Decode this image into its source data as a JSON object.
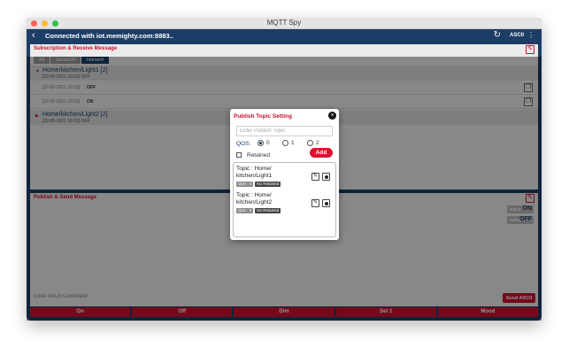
{
  "window": {
    "title": "MQTT Spy"
  },
  "appbar": {
    "connection": "Connected with iot.memighty.com:8883..",
    "ascii_label": "ASCII"
  },
  "subscribe": {
    "title": "Subscription & Receive Message",
    "filters": [
      "All",
      "Sensor/#",
      "Home/#"
    ],
    "groups": [
      {
        "name": "Home/kitchen/Light1 [2]",
        "latest": "[22-05-2021 16:02] OFF",
        "messages": [
          {
            "time": "[22-05-2021 16:02]",
            "value": "OFF"
          },
          {
            "time": "[22-05-2021 16:02]",
            "value": "ON"
          }
        ]
      },
      {
        "name": "Home/kitchen/Light2 [2]",
        "latest": "[22-05-2021 16:02] OFF"
      }
    ]
  },
  "publish": {
    "title": "Publish & Send Message",
    "toggles": [
      {
        "label": "ASCII",
        "state": "ON"
      },
      {
        "label": "ASCII",
        "state": "OFF"
      }
    ],
    "command_placeholder": "Enter ASCII Command",
    "send_label": "Send ASCII",
    "quick_buttons": [
      "On",
      "Off",
      "Dim",
      "Set 1",
      "Mood"
    ]
  },
  "modal": {
    "title": "Publish Topic Setting",
    "topic_placeholder": "Enter Publish Topic",
    "qos_label": "QOS:",
    "qos_options": [
      "0",
      "1",
      "2"
    ],
    "qos_selected": "0",
    "retained_label": "Retained",
    "retained_checked": false,
    "add_label": "Add",
    "topics": [
      {
        "name": "Topic : Home/ kitchen/Light1",
        "qos": "QoS : 0",
        "retained": "No Retained"
      },
      {
        "name": "Topic : Home/ kitchen/Light2",
        "qos": "QoS : 0",
        "retained": "No Retained"
      }
    ]
  },
  "colors": {
    "navy": "#1c3d66",
    "accent_red": "#c8102e",
    "add_red": "#e0102f"
  }
}
